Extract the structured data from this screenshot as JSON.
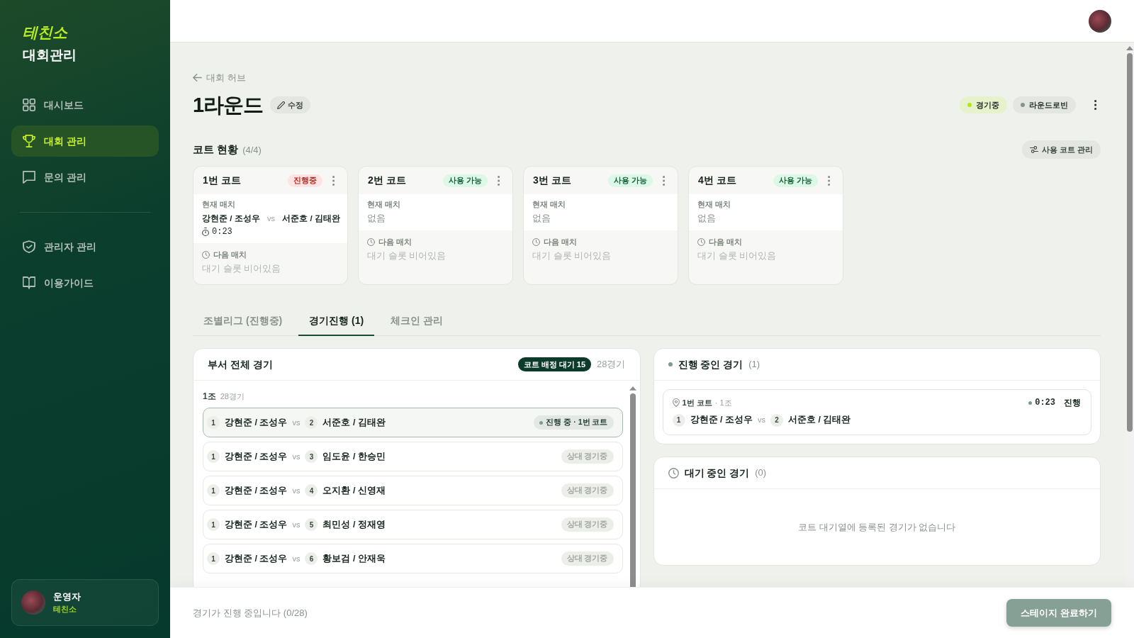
{
  "sidebar": {
    "logo": "테친소",
    "title": "대회관리",
    "nav": [
      {
        "label": "대시보드",
        "kind": "dashboard",
        "selected": false
      },
      {
        "label": "대회 관리",
        "kind": "tournament",
        "selected": true
      },
      {
        "label": "문의 관리",
        "kind": "inquiry",
        "selected": false
      }
    ],
    "nav_secondary": [
      {
        "label": "관리자 관리",
        "kind": "admin",
        "selected": false
      },
      {
        "label": "이용가이드",
        "kind": "guide",
        "selected": false
      }
    ],
    "user": {
      "name": "운영자",
      "org": "테친소"
    }
  },
  "page": {
    "back_link": "대회 허브",
    "title": "1라운드",
    "edit_button": "수정",
    "status_pills": [
      {
        "label": "경기중",
        "kind": "live",
        "color": "#b5e61d"
      },
      {
        "label": "라운드로빈",
        "kind": "format",
        "color": "#8a948e"
      }
    ]
  },
  "courts": {
    "title": "코트 현황",
    "count": "(4/4)",
    "manage_button": "사용 코트 관리",
    "items": [
      {
        "name": "1번 코트",
        "status": "진행중",
        "kind": "busy",
        "current_label": "현재 매치",
        "current_match": {
          "team_a": "강현준 / 조성우",
          "vs": "vs",
          "team_b": "서준호 / 김태완",
          "timer": "0:23"
        },
        "next_label": "다음 매치",
        "next_value": "대기 슬롯 비어있음"
      },
      {
        "name": "2번 코트",
        "status": "사용 가능",
        "kind": "free",
        "current_label": "현재 매치",
        "current_value": "없음",
        "next_label": "다음 매치",
        "next_value": "대기 슬롯 비어있음"
      },
      {
        "name": "3번 코트",
        "status": "사용 가능",
        "kind": "free",
        "current_label": "현재 매치",
        "current_value": "없음",
        "next_label": "다음 매치",
        "next_value": "대기 슬롯 비어있음"
      },
      {
        "name": "4번 코트",
        "status": "사용 가능",
        "kind": "free",
        "current_label": "현재 매치",
        "current_value": "없음",
        "next_label": "다음 매치",
        "next_value": "대기 슬롯 비어있음"
      }
    ]
  },
  "tabs": [
    {
      "label": "조별리그 (진행중)",
      "selected": false
    },
    {
      "label": "경기진행 (1)",
      "selected": true
    },
    {
      "label": "체크인 관리",
      "selected": false
    }
  ],
  "all_matches": {
    "title": "부서 전체 경기",
    "queue_badge": "코트 배정 대기 15",
    "count": "28경기",
    "groups": [
      {
        "name": "1조",
        "count": "28경기",
        "matches": [
          {
            "seed_a": "1",
            "team_a": "강현준 / 조성우",
            "vs": "vs",
            "seed_b": "2",
            "team_b": "서준호 / 김태완",
            "status": "진행 중 · 1번 코트",
            "kind": "live"
          },
          {
            "seed_a": "1",
            "team_a": "강현준 / 조성우",
            "vs": "vs",
            "seed_b": "3",
            "team_b": "임도윤 / 한승민",
            "status": "상대 경기중",
            "kind": "blocked"
          },
          {
            "seed_a": "1",
            "team_a": "강현준 / 조성우",
            "vs": "vs",
            "seed_b": "4",
            "team_b": "오지환 / 신영재",
            "status": "상대 경기중",
            "kind": "blocked"
          },
          {
            "seed_a": "1",
            "team_a": "강현준 / 조성우",
            "vs": "vs",
            "seed_b": "5",
            "team_b": "최민성 / 정재영",
            "status": "상대 경기중",
            "kind": "blocked"
          },
          {
            "seed_a": "1",
            "team_a": "강현준 / 조성우",
            "vs": "vs",
            "seed_b": "6",
            "team_b": "황보검 / 안재욱",
            "status": "상대 경기중",
            "kind": "blocked"
          }
        ]
      }
    ]
  },
  "in_progress": {
    "title": "진행 중인 경기",
    "count": "(1)",
    "matches": [
      {
        "court": "1번 코트",
        "group": "· 1조",
        "timer": "0:23",
        "state": "진행",
        "seed_a": "1",
        "team_a": "강현준 / 조성우",
        "vs": "vs",
        "seed_b": "2",
        "team_b": "서준호 / 김태완"
      }
    ]
  },
  "queue": {
    "title": "대기 중인 경기",
    "count": "(0)",
    "empty_text": "코트 대기열에 등록된 경기가 없습니다"
  },
  "footer": {
    "status": "경기가 진행 중입니다 (0/28)",
    "complete_button": {
      "label": "스테이지 완료하기",
      "disabled": true
    }
  }
}
